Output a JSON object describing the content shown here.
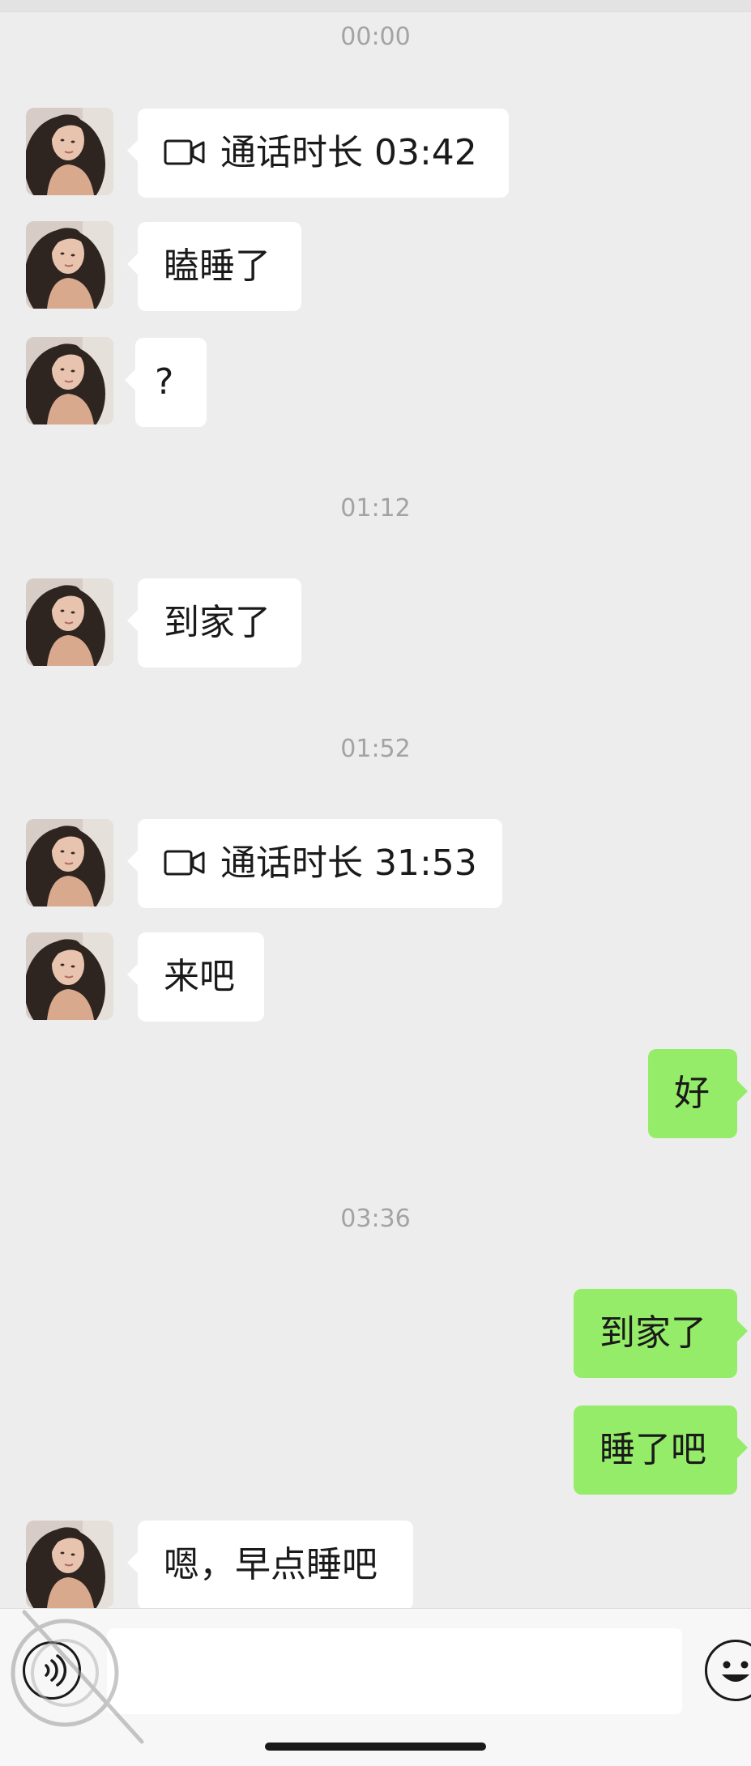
{
  "chat": {
    "timestamps": [
      "00:00",
      "01:12",
      "01:52",
      "03:36"
    ],
    "messages": [
      {
        "type": "call",
        "label": "通话时长 03:42"
      },
      {
        "type": "text",
        "text": "瞌睡了"
      },
      {
        "type": "text",
        "text": "?"
      },
      {
        "type": "text",
        "text": "到家了"
      },
      {
        "type": "call",
        "label": "通话时长 31:53"
      },
      {
        "type": "text",
        "text": "来吧"
      },
      {
        "type": "text",
        "text": "好"
      },
      {
        "type": "text",
        "text": "到家了"
      },
      {
        "type": "text",
        "text": "睡了吧"
      },
      {
        "type": "text",
        "text": "嗯，早点睡吧"
      }
    ]
  },
  "input_bar": {
    "voice_icon": "voice-icon",
    "emoji_icon": "emoji-icon",
    "text_value": ""
  },
  "colors": {
    "background": "#ededed",
    "incoming_bubble": "#ffffff",
    "outgoing_bubble": "#95ec69"
  }
}
